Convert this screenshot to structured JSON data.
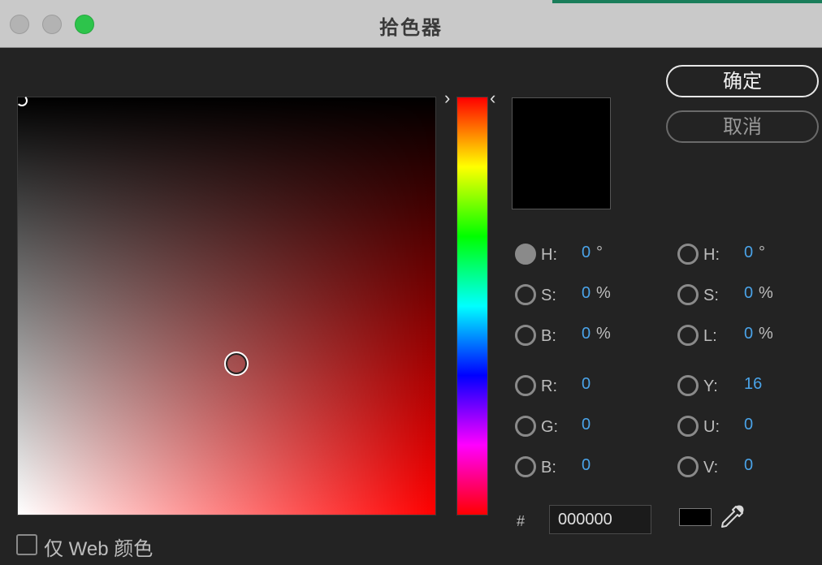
{
  "window": {
    "title": "拾色器"
  },
  "buttons": {
    "ok": "确定",
    "cancel": "取消"
  },
  "fields_left": [
    {
      "label": "H:",
      "value": "0",
      "unit": "°",
      "checked": true
    },
    {
      "label": "S:",
      "value": "0",
      "unit": "%",
      "checked": false
    },
    {
      "label": "B:",
      "value": "0",
      "unit": "%",
      "checked": false
    },
    {
      "label": "R:",
      "value": "0",
      "unit": "",
      "checked": false
    },
    {
      "label": "G:",
      "value": "0",
      "unit": "",
      "checked": false
    },
    {
      "label": "B:",
      "value": "0",
      "unit": "",
      "checked": false
    }
  ],
  "fields_right": [
    {
      "label": "H:",
      "value": "0",
      "unit": "°",
      "checked": false
    },
    {
      "label": "S:",
      "value": "0",
      "unit": "%",
      "checked": false
    },
    {
      "label": "L:",
      "value": "0",
      "unit": "%",
      "checked": false
    },
    {
      "label": "Y:",
      "value": "16",
      "unit": "",
      "checked": false
    },
    {
      "label": "U:",
      "value": "0",
      "unit": "",
      "checked": false
    },
    {
      "label": "V:",
      "value": "0",
      "unit": "",
      "checked": false
    }
  ],
  "hex": {
    "prefix": "#",
    "value": "000000"
  },
  "web_only": {
    "label": "仅 Web 颜色",
    "checked": false
  },
  "colors": {
    "current": "#000000",
    "value_accent": "#4aa3e8"
  },
  "icons": {
    "eyedropper": "eyedropper-icon",
    "slider_left": "chevron-right-icon",
    "slider_right": "chevron-left-icon"
  }
}
